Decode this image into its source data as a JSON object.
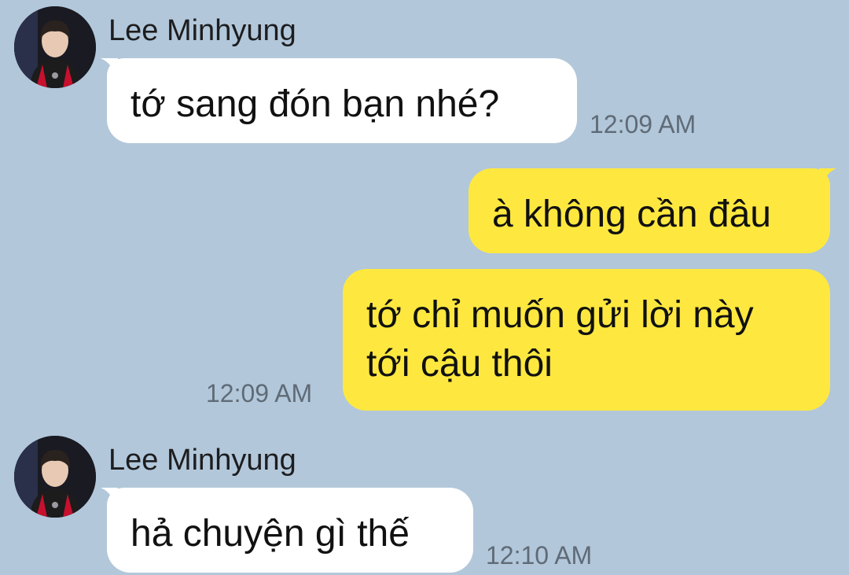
{
  "colors": {
    "background": "#b2c7da",
    "incoming_bubble": "#ffffff",
    "outgoing_bubble": "#fee83f",
    "timestamp": "#5f6b77"
  },
  "messages": [
    {
      "direction": "incoming",
      "sender": "Lee Minhyung",
      "avatar_icon": "profile-photo-icon",
      "text": "tớ sang đón bạn nhé?",
      "time": "12:09 AM"
    },
    {
      "direction": "outgoing",
      "text": "à không cần đâu"
    },
    {
      "direction": "outgoing",
      "line1": "tớ chỉ muốn gửi lời này",
      "line2": "tới cậu thôi",
      "time": "12:09 AM"
    },
    {
      "direction": "incoming",
      "sender": "Lee Minhyung",
      "avatar_icon": "profile-photo-icon",
      "text": "hả chuyện gì thế",
      "time": "12:10 AM"
    }
  ]
}
